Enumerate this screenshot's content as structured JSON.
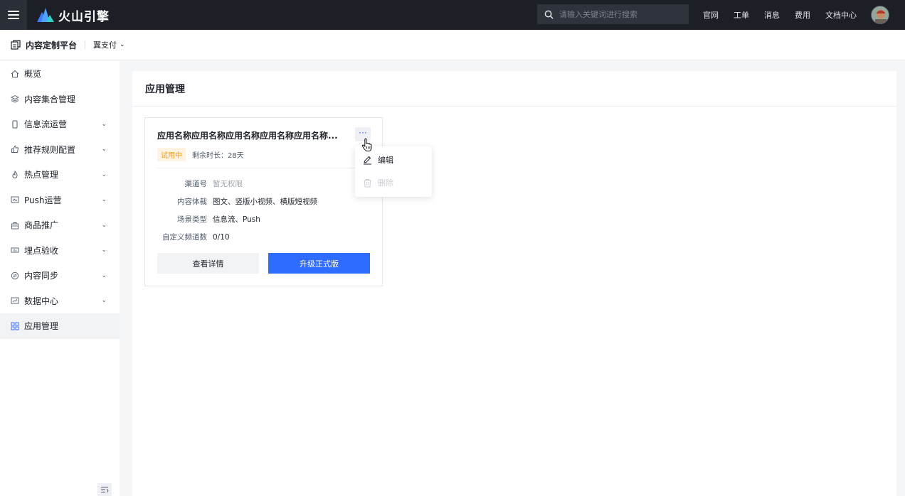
{
  "topbar": {
    "brand": "火山引擎",
    "search_placeholder": "请输入关键词进行搜索",
    "links": [
      "官网",
      "工单",
      "消息",
      "费用",
      "文档中心"
    ]
  },
  "subheader": {
    "platform": "内容定制平台",
    "project": "翼支付"
  },
  "sidebar": {
    "items": [
      {
        "label": "概览",
        "icon": "home-icon",
        "expandable": false
      },
      {
        "label": "内容集合管理",
        "icon": "layers-icon",
        "expandable": false
      },
      {
        "label": "信息流运营",
        "icon": "phone-icon",
        "expandable": true
      },
      {
        "label": "推荐规则配置",
        "icon": "thumb-up-icon",
        "expandable": true
      },
      {
        "label": "热点管理",
        "icon": "flame-icon",
        "expandable": true
      },
      {
        "label": "Push运营",
        "icon": "push-icon",
        "expandable": true
      },
      {
        "label": "商品推广",
        "icon": "bag-icon",
        "expandable": true
      },
      {
        "label": "埋点验收",
        "icon": "keyboard-icon",
        "expandable": true
      },
      {
        "label": "内容同步",
        "icon": "sync-icon",
        "expandable": true
      },
      {
        "label": "数据中心",
        "icon": "chart-icon",
        "expandable": true
      },
      {
        "label": "应用管理",
        "icon": "grid-icon",
        "expandable": false,
        "active": true
      }
    ]
  },
  "main": {
    "title": "应用管理",
    "card": {
      "name": "应用名称应用名称应用名称应用名称应用名称...",
      "badge": "试用中",
      "remaining": "剩余时长：28天",
      "fields": [
        {
          "key": "渠道号",
          "value": "暂无权限",
          "muted": true
        },
        {
          "key": "内容体裁",
          "value": "图文、竖版小视频、横版短视频",
          "muted": false
        },
        {
          "key": "场景类型",
          "value": "信息流、Push",
          "muted": false
        },
        {
          "key": "自定义频道数",
          "value": "0/10",
          "muted": false
        }
      ],
      "detail_button": "查看详情",
      "upgrade_button": "升级正式版"
    },
    "dropdown": {
      "edit": "编辑",
      "delete": "删除"
    }
  },
  "colors": {
    "topbar_bg": "#1c1f26",
    "primary": "#2e6bff",
    "badge_text": "#f09a1a",
    "badge_bg": "#fff3e2"
  }
}
